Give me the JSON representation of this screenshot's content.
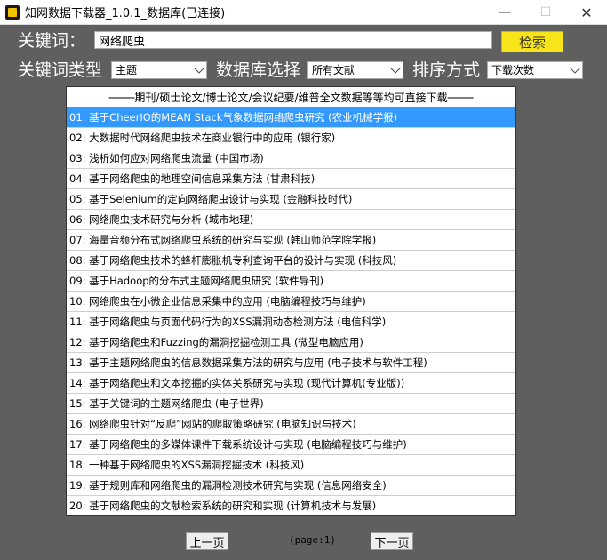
{
  "window": {
    "title": "知网数据下载器_1.0.1_数据库(已连接)",
    "min_glyph": "—",
    "max_glyph": "☐",
    "close_glyph": "✕"
  },
  "search": {
    "label": "关键词：",
    "value": "网络爬虫",
    "button": "检索"
  },
  "filters": {
    "type_label": "关键词类型",
    "type_value": "主题",
    "db_label": "数据库选择",
    "db_value": "所有文献",
    "sort_label": "排序方式",
    "sort_value": "下载次数"
  },
  "list": {
    "header": "────期刊/硕士论文/博士论文/会议纪要/维普全文数据等等均可直接下载────",
    "selected_index": 0,
    "items": [
      "01: 基于CheerIO的MEAN Stack气象数据网络爬虫研究 (农业机械学报)",
      "02: 大数据时代网络爬虫技术在商业银行中的应用 (银行家)",
      "03: 浅析如何应对网络爬虫流量 (中国市场)",
      "04: 基于网络爬虫的地理空间信息采集方法 (甘肃科技)",
      "05: 基于Selenium的定向网络爬虫设计与实现 (金融科技时代)",
      "06: 网络爬虫技术研究与分析 (城市地理)",
      "07: 海量音频分布式网络爬虫系统的研究与实现 (韩山师范学院学报)",
      "08: 基于网络爬虫技术的蜂杆膨胀机专利查询平台的设计与实现 (科技风)",
      "09: 基于Hadoop的分布式主题网络爬虫研究 (软件导刊)",
      "10: 网络爬虫在小微企业信息采集中的应用 (电脑编程技巧与维护)",
      "11: 基于网络爬虫与页面代码行为的XSS漏洞动态检测方法 (电信科学)",
      "12: 基于网络爬虫和Fuzzing的漏洞挖掘检测工具 (微型电脑应用)",
      "13: 基于主题网络爬虫的信息数据采集方法的研究与应用 (电子技术与软件工程)",
      "14: 基于网络爬虫和文本挖掘的实体关系研究与实现 (现代计算机(专业版))",
      "15: 基于关键词的主题网络爬虫 (电子世界)",
      "16: 网络爬虫针对“反爬”网站的爬取策略研究 (电脑知识与技术)",
      "17: 基于网络爬虫的多媒体课件下载系统设计与实现 (电脑编程技巧与维护)",
      "18: 一种基于网络爬虫的XSS漏洞挖掘技术 (科技风)",
      "19: 基于规则库和网络爬虫的漏洞检测技术研究与实现 (信息网络安全)",
      "20: 基于网络爬虫的文献检索系统的研究和实现 (计算机技术与发展)"
    ]
  },
  "pager": {
    "prev": "上一页",
    "page_label": "(page:1)",
    "next": "下一页"
  },
  "colors": {
    "background": "#5f5f5f",
    "search_button": "#f7e51a",
    "selected_row": "#3399ff"
  }
}
